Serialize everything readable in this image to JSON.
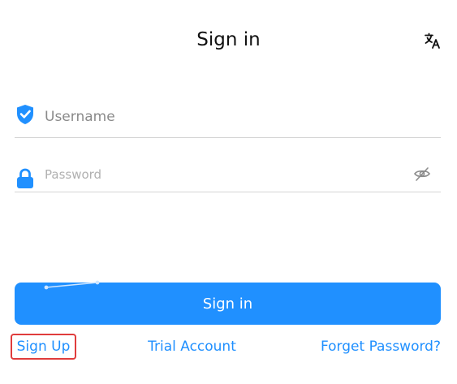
{
  "header": {
    "title": "Sign in",
    "language_icon": "translate-icon"
  },
  "form": {
    "username": {
      "placeholder": "Username",
      "value": "",
      "icon": "shield-check-icon"
    },
    "password": {
      "placeholder": "Password",
      "value": "",
      "icon": "lock-icon",
      "toggle_icon": "eye-off-icon"
    },
    "submit_label": "Sign in"
  },
  "links": {
    "sign_up": "Sign Up",
    "trial_account": "Trial Account",
    "forget_password": "Forget Password?"
  },
  "colors": {
    "accent": "#2090ff",
    "highlight_border": "#e03c3c",
    "divider": "#d4d4d4"
  }
}
